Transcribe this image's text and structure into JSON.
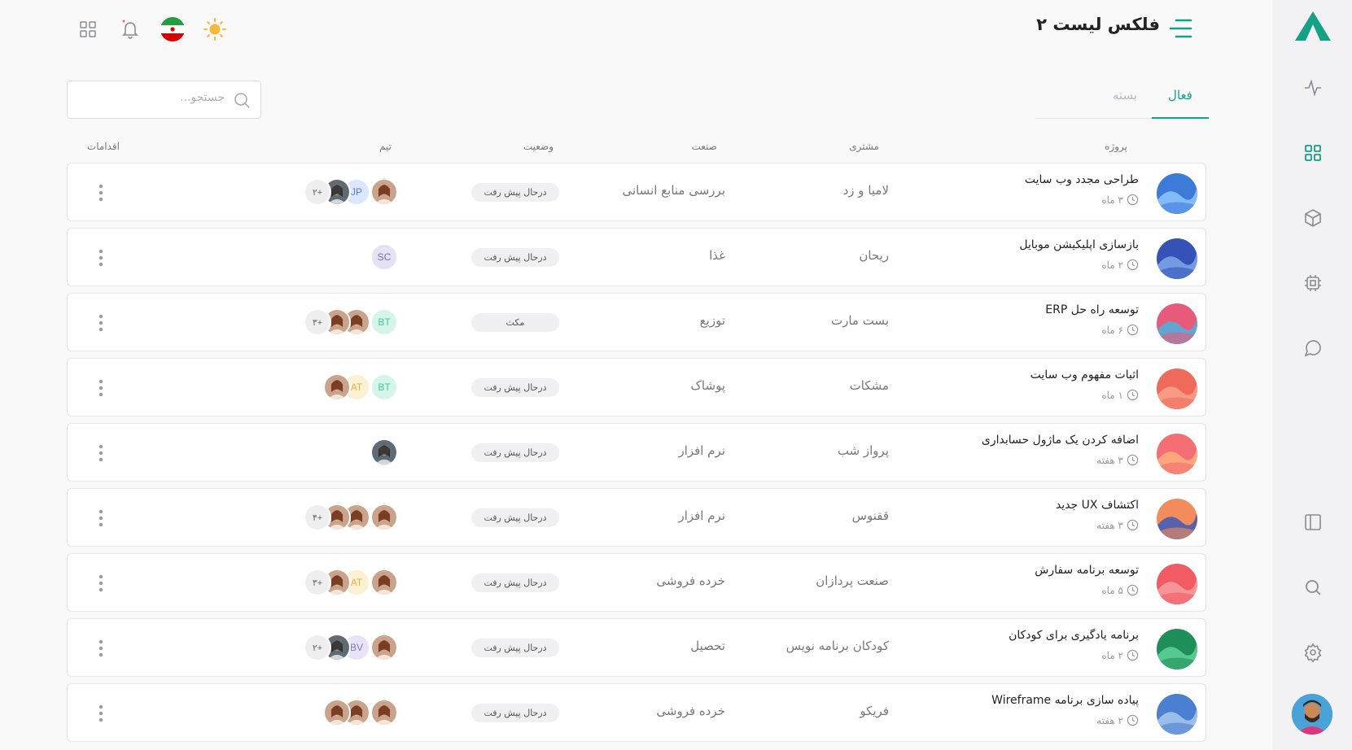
{
  "app": {
    "title": "فلکس لیست ۲",
    "accent": "#16a085"
  },
  "header": {
    "icons": [
      "apps-grid-icon",
      "bell-icon",
      "iran-flag-icon",
      "sun-icon"
    ]
  },
  "sidebar": {
    "icons": [
      "logo-icon",
      "activity-icon",
      "grid-icon",
      "box-icon",
      "cpu-icon",
      "chat-icon",
      "layout-icon",
      "search-icon",
      "settings-icon"
    ]
  },
  "tabs": [
    {
      "label": "فعال",
      "active": true
    },
    {
      "label": "بسته",
      "active": false
    }
  ],
  "search": {
    "placeholder": "جستجو..."
  },
  "table": {
    "headers": {
      "project": "پروژه",
      "client": "مشتری",
      "industry": "صنعت",
      "status": "وضعیت",
      "team": "تیم",
      "actions": "اقدامات"
    },
    "rows": [
      {
        "name": "طراحی مجدد وب سایت",
        "duration": "۳ ماه",
        "client": "لامیا و زد",
        "industry": "بررسی منابع انسانی",
        "status": "درحال پیش رفت",
        "team": [
          "photo-woman",
          "JP",
          "photo-man",
          "+۲"
        ]
      },
      {
        "name": "بازسازی اپلیکیشن موبایل",
        "duration": "۲ ماه",
        "client": "ریحان",
        "industry": "غذا",
        "status": "درحال پیش رفت",
        "team": [
          "SC"
        ]
      },
      {
        "name": "توسعه راه حل ERP",
        "duration": "۶ ماه",
        "client": "بست مارت",
        "industry": "توزیع",
        "status": "مکث",
        "team": [
          "BT",
          "photo-woman",
          "photo-woman",
          "+۳"
        ]
      },
      {
        "name": "اثبات مفهوم وب سایت",
        "duration": "۱ ماه",
        "client": "مشکات",
        "industry": "پوشاک",
        "status": "درحال پیش رفت",
        "team": [
          "BT",
          "AT",
          "photo-woman"
        ]
      },
      {
        "name": "اضافه کردن یک ماژول حسابداری",
        "duration": "۳ هفته",
        "client": "پرواز شب",
        "industry": "نرم افزار",
        "status": "درحال پیش رفت",
        "team": [
          "photo-man"
        ]
      },
      {
        "name": "اکتشاف UX جدید",
        "duration": "۳ هفته",
        "client": "ققنوس",
        "industry": "نرم افزار",
        "status": "درحال پیش رفت",
        "team": [
          "photo-woman",
          "photo-woman",
          "photo-woman",
          "+۴"
        ]
      },
      {
        "name": "توسعه برنامه سفارش",
        "duration": "۵ ماه",
        "client": "صنعت پردازان",
        "industry": "خرده فروشی",
        "status": "درحال پیش رفت",
        "team": [
          "photo-woman",
          "AT",
          "photo-woman",
          "+۳"
        ]
      },
      {
        "name": "برنامه یادگیری برای کودکان",
        "duration": "۲ ماه",
        "client": "کودکان برنامه نویس",
        "industry": "تحصیل",
        "status": "درحال پیش رفت",
        "team": [
          "photo-woman",
          "BV",
          "photo-man",
          "+۲"
        ]
      },
      {
        "name": "پیاده سازی برنامه Wireframe",
        "duration": "۲ هفته",
        "client": "فریکو",
        "industry": "خرده فروشی",
        "status": "درحال پیش رفت",
        "team": [
          "photo-woman",
          "photo-woman",
          "photo-woman"
        ]
      }
    ]
  }
}
